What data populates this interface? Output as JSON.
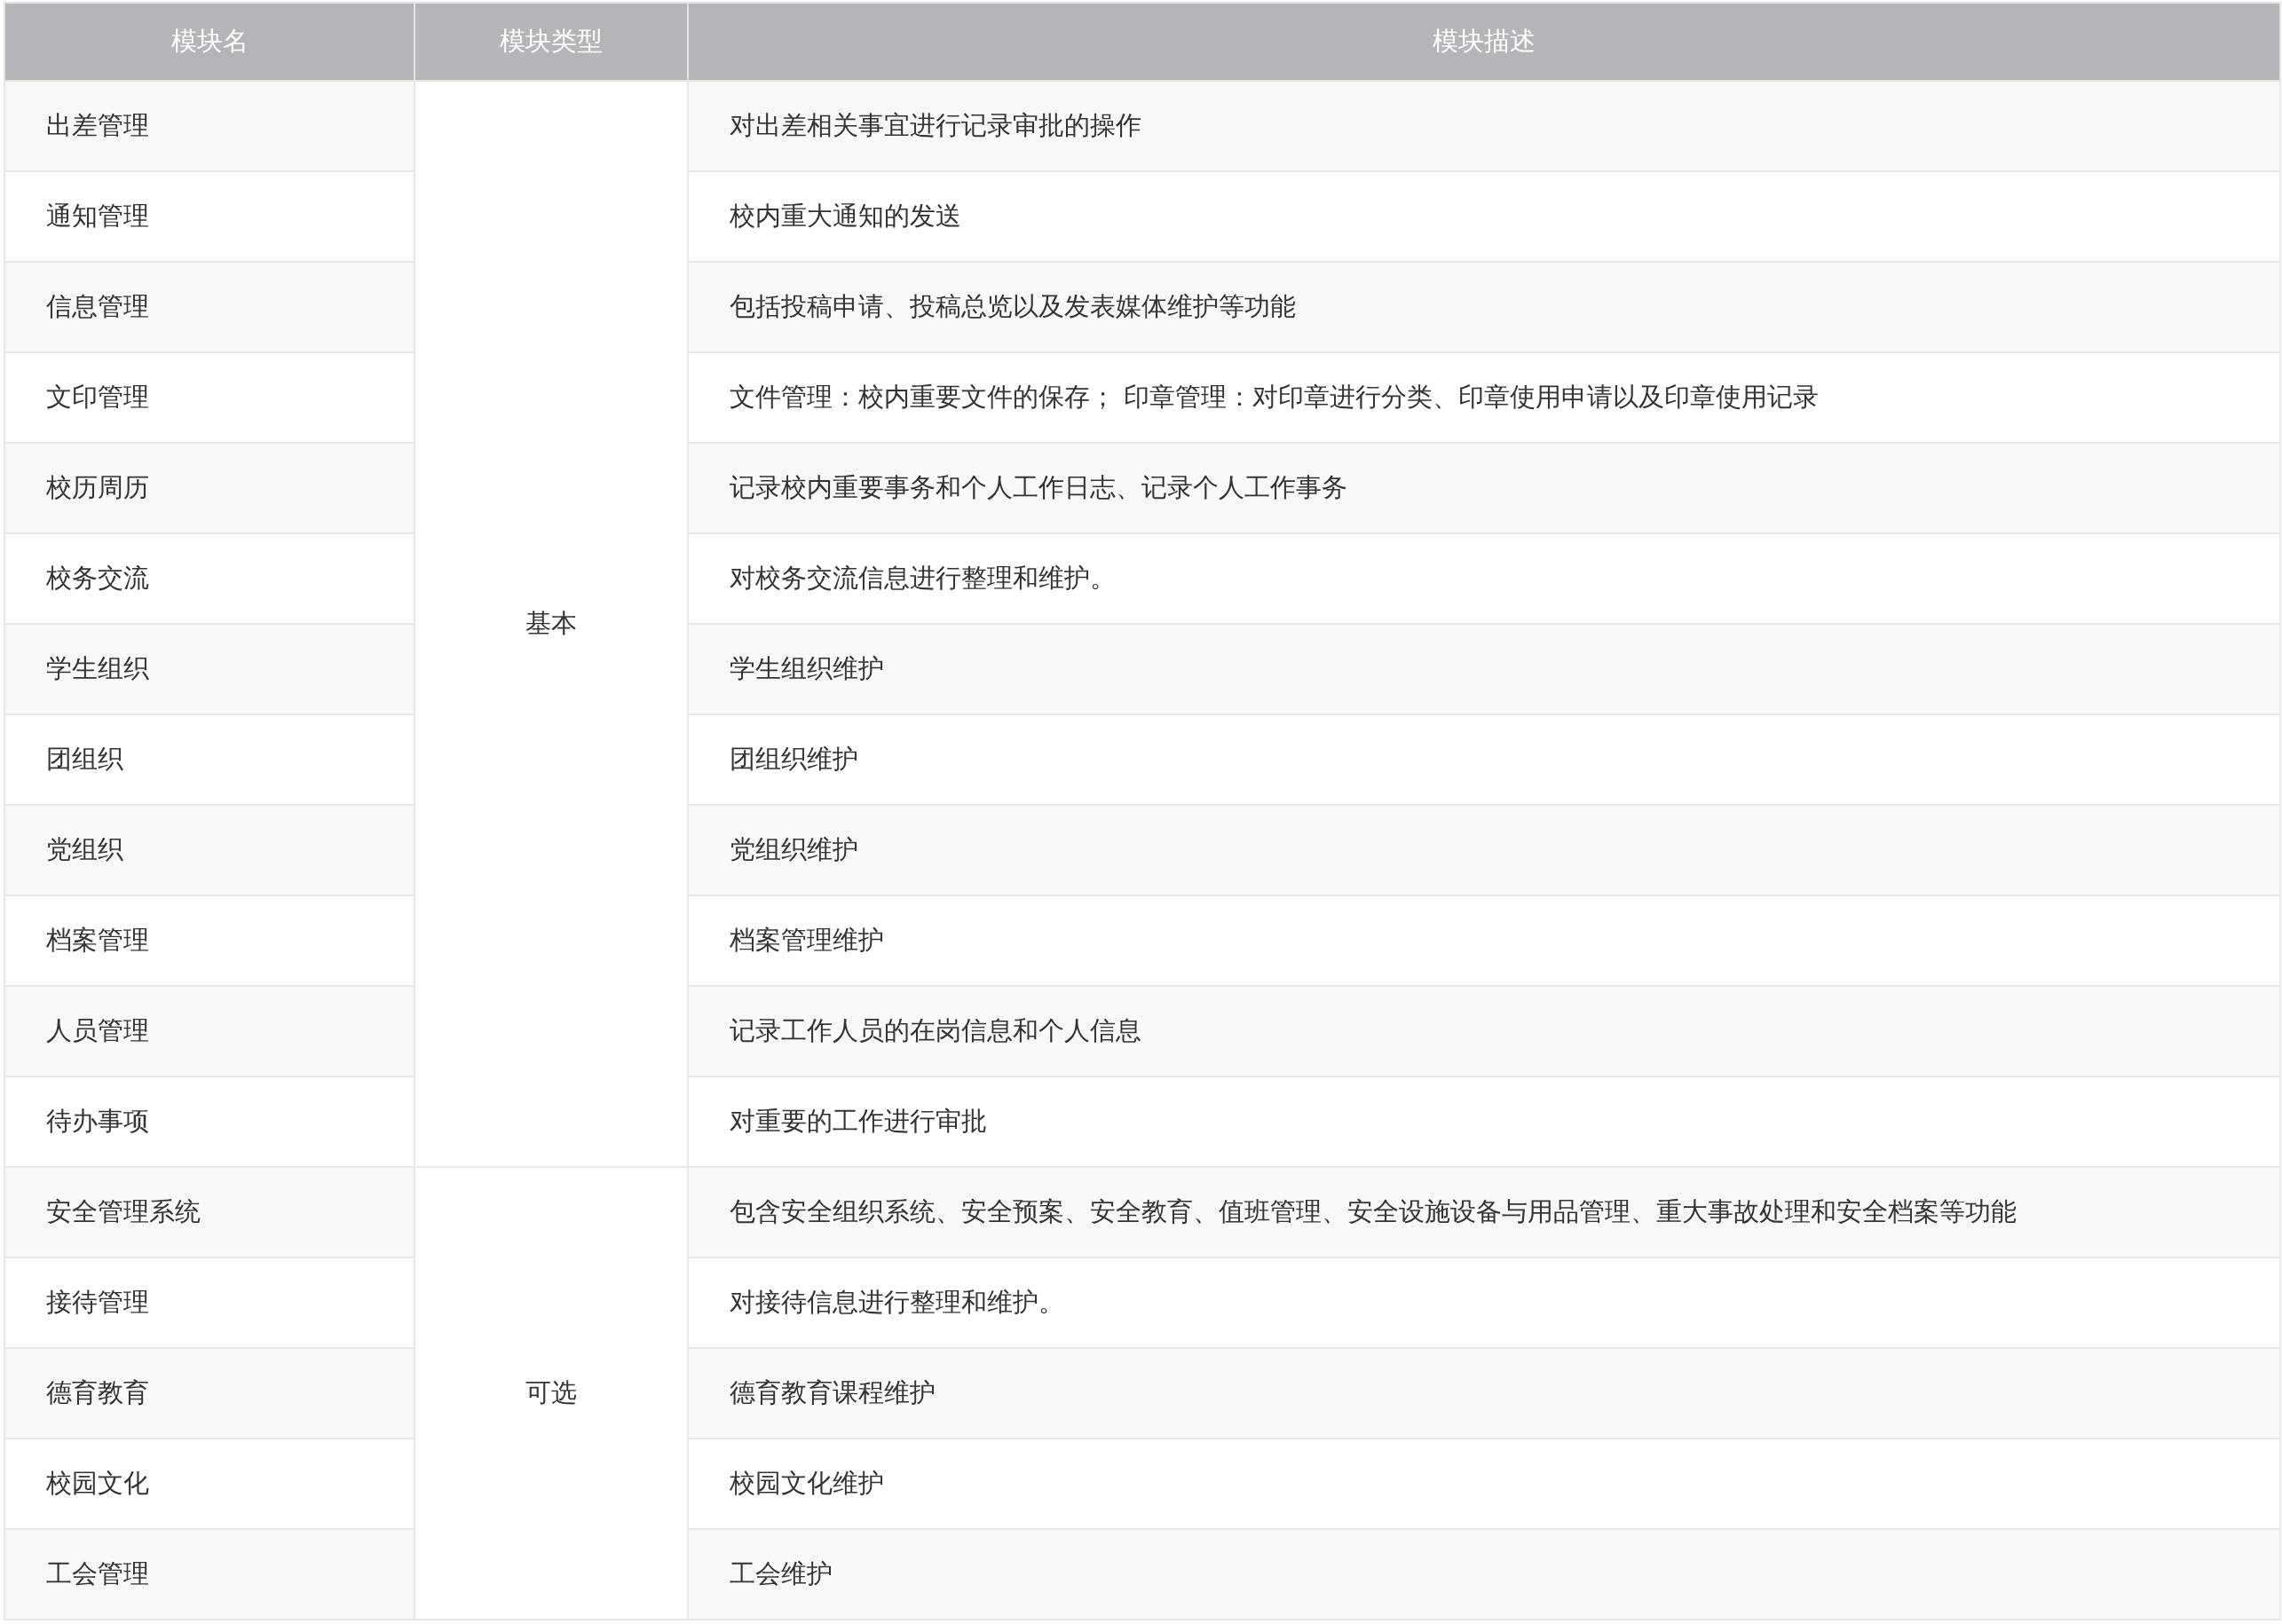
{
  "table": {
    "columns": [
      "模块名",
      "模块类型",
      "模块描述"
    ],
    "groups": [
      {
        "type": "基本",
        "rows": [
          {
            "name": "出差管理",
            "description": "对出差相关事宜进行记录审批的操作"
          },
          {
            "name": "通知管理",
            "description": "校内重大通知的发送"
          },
          {
            "name": "信息管理",
            "description": "包括投稿申请、投稿总览以及发表媒体维护等功能"
          },
          {
            "name": "文印管理",
            "description": "文件管理：校内重要文件的保存； 印章管理：对印章进行分类、印章使用申请以及印章使用记录"
          },
          {
            "name": "校历周历",
            "description": "记录校内重要事务和个人工作日志、记录个人工作事务"
          },
          {
            "name": "校务交流",
            "description": "对校务交流信息进行整理和维护。"
          },
          {
            "name": "学生组织",
            "description": "学生组织维护"
          },
          {
            "name": "团组织",
            "description": "团组织维护"
          },
          {
            "name": "党组织",
            "description": "党组织维护"
          },
          {
            "name": "档案管理",
            "description": "档案管理维护"
          },
          {
            "name": "人员管理",
            "description": "记录工作人员的在岗信息和个人信息"
          },
          {
            "name": "待办事项",
            "description": "对重要的工作进行审批"
          }
        ]
      },
      {
        "type": "可选",
        "rows": [
          {
            "name": "安全管理系统",
            "description": "包含安全组织系统、安全预案、安全教育、值班管理、安全设施设备与用品管理、重大事故处理和安全档案等功能"
          },
          {
            "name": "接待管理",
            "description": "对接待信息进行整理和维护。"
          },
          {
            "name": "德育教育",
            "description": "德育教育课程维护"
          },
          {
            "name": "校园文化",
            "description": "校园文化维护"
          },
          {
            "name": "工会管理",
            "description": "工会维护"
          }
        ]
      }
    ]
  }
}
